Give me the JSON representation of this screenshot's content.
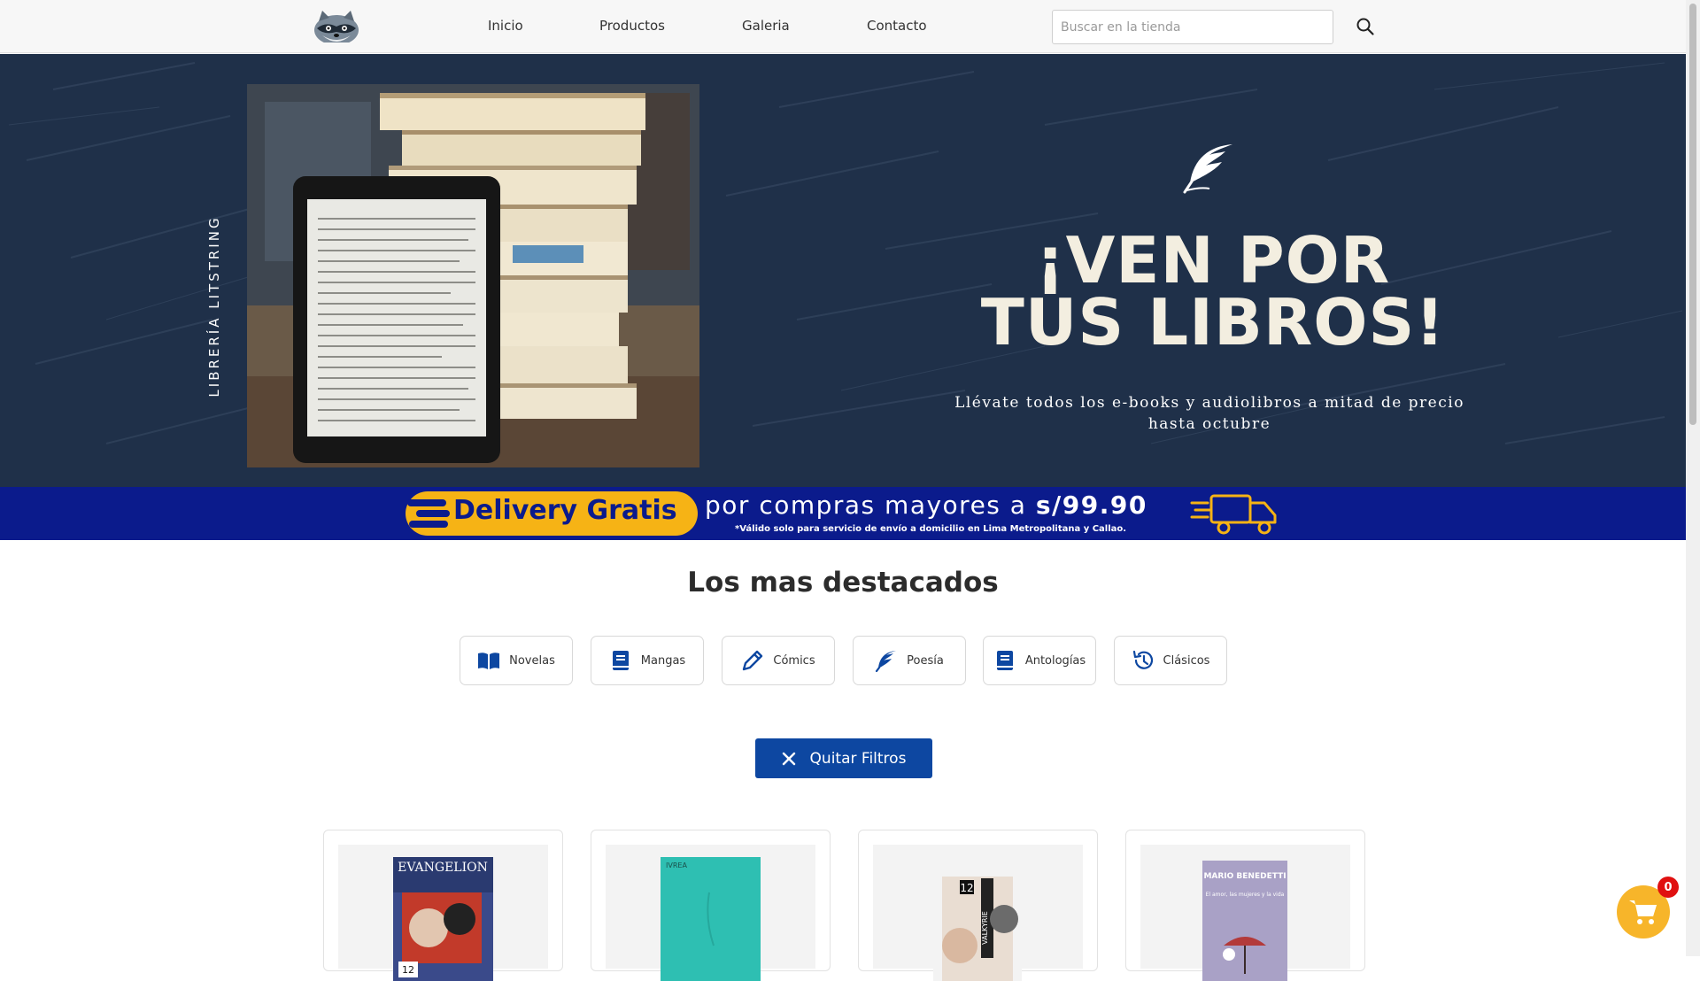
{
  "nav": {
    "logo_icon": "raccoon-logo-icon",
    "links": [
      "Inicio",
      "Productos",
      "Galeria",
      "Contacto"
    ],
    "search_placeholder": "Buscar en la tienda",
    "search_icon": "search-icon"
  },
  "hero": {
    "brand_vertical": "LIBRERÍA LITSTRING",
    "icon": "quill-feather-icon",
    "title_line1": "¡VEN POR",
    "title_line2": "TUS LIBROS!",
    "subtitle": "Llévate todos los e-books y audiolibros a mitad de precio hasta octubre",
    "background_color": "#1d2d44",
    "title_color": "#f3eee0"
  },
  "delivery": {
    "badge": "Delivery Gratis",
    "main_text": "por compras mayores a",
    "price": "s/99.90",
    "note": "*Válido solo para servicio de envío a domicilio en Lima Metropolitana y Callao.",
    "truck_icon": "delivery-truck-icon",
    "background_color": "#0b1b8c",
    "accent_color": "#f6b315"
  },
  "featured": {
    "title": "Los mas destacados",
    "categories": [
      {
        "label": "Novelas",
        "icon": "open-book-icon"
      },
      {
        "label": "Mangas",
        "icon": "book-icon"
      },
      {
        "label": "Cómics",
        "icon": "pencil-icon"
      },
      {
        "label": "Poesía",
        "icon": "feather-icon"
      },
      {
        "label": "Antologías",
        "icon": "book-icon"
      },
      {
        "label": "Clásicos",
        "icon": "history-icon"
      }
    ],
    "clear_filters": "Quitar Filtros",
    "clear_icon": "close-icon",
    "accent_color": "#0d47a1"
  },
  "products": {
    "covers": [
      {
        "title": "EVANGELION",
        "volume": "12"
      },
      {
        "title": "",
        "publisher": "IVREA"
      },
      {
        "title": "VALKYRIE",
        "volume": "12"
      },
      {
        "title": "El amor, las mujeres y la vida",
        "author": "MARIO BENEDETTI"
      }
    ]
  },
  "cart": {
    "icon": "shopping-cart-icon",
    "count": "0",
    "color": "#f7b52a"
  }
}
